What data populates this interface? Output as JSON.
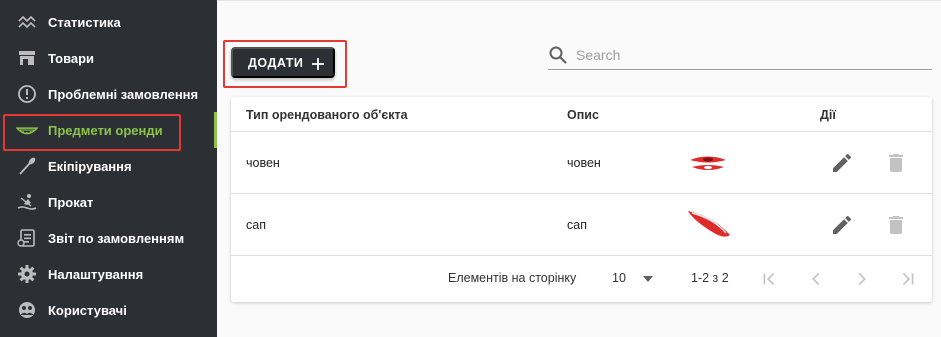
{
  "sidebar": {
    "items": [
      {
        "label": "Статистика",
        "icon": "chart-line-icon"
      },
      {
        "label": "Товари",
        "icon": "store-icon"
      },
      {
        "label": "Проблемні замовлення",
        "icon": "alert-circle-icon"
      },
      {
        "label": "Предмети оренди",
        "icon": "kayak-icon"
      },
      {
        "label": "Екіпірування",
        "icon": "paddle-icon"
      },
      {
        "label": "Прокат",
        "icon": "rowing-icon"
      },
      {
        "label": "Звіт по замовленням",
        "icon": "report-icon"
      },
      {
        "label": "Налаштування",
        "icon": "gear-icon"
      },
      {
        "label": "Користувачі",
        "icon": "users-icon"
      }
    ],
    "active_index": 3,
    "colors": {
      "background": "#2c3035",
      "active": "#8bc34a"
    }
  },
  "toolbar": {
    "add_label": "ДОДАТИ",
    "add_icon": "plus-icon"
  },
  "search": {
    "placeholder": "Search",
    "value": ""
  },
  "table": {
    "columns": [
      "Тип орендованого об'єкта",
      "Опис",
      "Дії"
    ],
    "rows": [
      {
        "type": "човен",
        "description": "човен",
        "image": "red-kayak"
      },
      {
        "type": "сап",
        "description": "сап",
        "image": "red-sup-board"
      }
    ]
  },
  "pagination": {
    "per_page_label": "Елементів на сторінку",
    "per_page_value": "10",
    "range_label": "1-2 з 2"
  },
  "colors": {
    "highlight": "#e53935",
    "accent_red": "#e02b2b"
  }
}
